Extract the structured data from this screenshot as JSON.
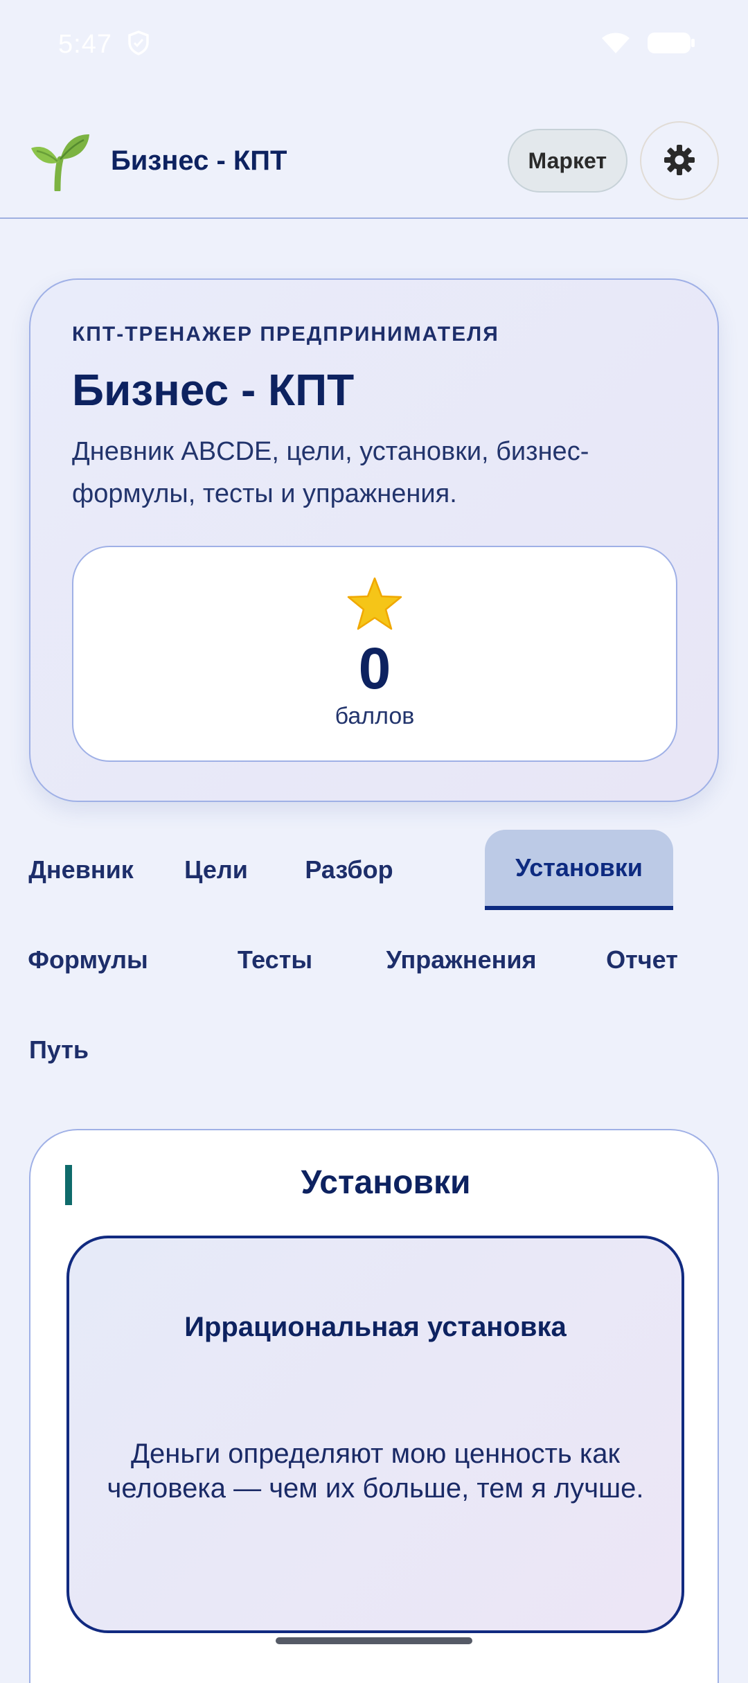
{
  "status_bar": {
    "time": "5:47",
    "icons": [
      "shield-icon",
      "wifi-icon",
      "battery-icon"
    ]
  },
  "header": {
    "logo_icon": "sprout-icon",
    "title": "Бизнес - КПТ",
    "market_label": "Маркет",
    "settings_icon": "gear-icon"
  },
  "hero": {
    "eyebrow": "КПТ-ТРЕНАЖЕР ПРЕДПРИНИМАТЕЛЯ",
    "title": "Бизнес - КПТ",
    "description": "Дневник ABCDE, цели, установки, бизнес-формулы, тесты и упражнения.",
    "score": {
      "icon": "star-icon",
      "value": "0",
      "label": "баллов"
    }
  },
  "tabs": {
    "row1": [
      {
        "label": "Дневник"
      },
      {
        "label": "Цели"
      },
      {
        "label": "Разбор"
      },
      {
        "label": "Установки",
        "active": true
      }
    ],
    "row2": [
      {
        "label": "Формулы"
      },
      {
        "label": "Тесты"
      },
      {
        "label": "Упражнения"
      },
      {
        "label": "Отчет"
      }
    ],
    "row3": [
      {
        "label": "Путь"
      }
    ]
  },
  "section": {
    "title": "Установки",
    "belief": {
      "label": "Иррациональная установка",
      "text": "Деньги определяют мою ценность как человека — чем их больше, тем я лучше."
    }
  },
  "colors": {
    "background": "#eef1fb",
    "primary_text": "#0d2260",
    "active_tab_bg": "#bccae6",
    "accent_teal": "#0f6b6b",
    "star": "#f5c518"
  }
}
